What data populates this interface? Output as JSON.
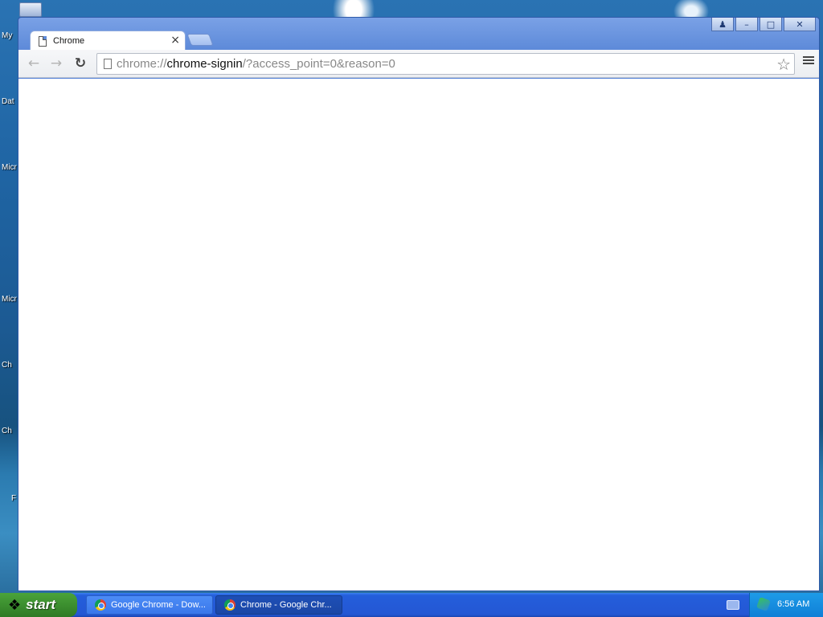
{
  "desktop": {
    "icon_labels": [
      "My",
      "Dat",
      "Micr",
      "Micr",
      "Ch",
      "Ch",
      "F"
    ]
  },
  "window": {
    "tab": {
      "title": "Chrome",
      "favicon": "page-icon",
      "close": "×"
    },
    "controls": {
      "profile": "person-icon",
      "minimize": "–",
      "maximize": "□",
      "close": "✕"
    },
    "toolbar": {
      "back": "←",
      "forward": "→",
      "reload": "↻",
      "url_scheme": "chrome://",
      "url_host": "chrome-signin",
      "url_rest": "/?access_point=0&reason=0",
      "bookmark_star": "☆"
    }
  },
  "taskbar": {
    "start_label": "start",
    "tasks": [
      {
        "label": "Google Chrome - Dow...",
        "active": false
      },
      {
        "label": "Chrome - Google Chr...",
        "active": true
      }
    ],
    "clock": "6:56 AM"
  },
  "colors": {
    "window_frame": "#5a86da",
    "taskbar": "#2457d4",
    "start_button": "#3c8f2f",
    "tray": "#0f7fd6"
  }
}
